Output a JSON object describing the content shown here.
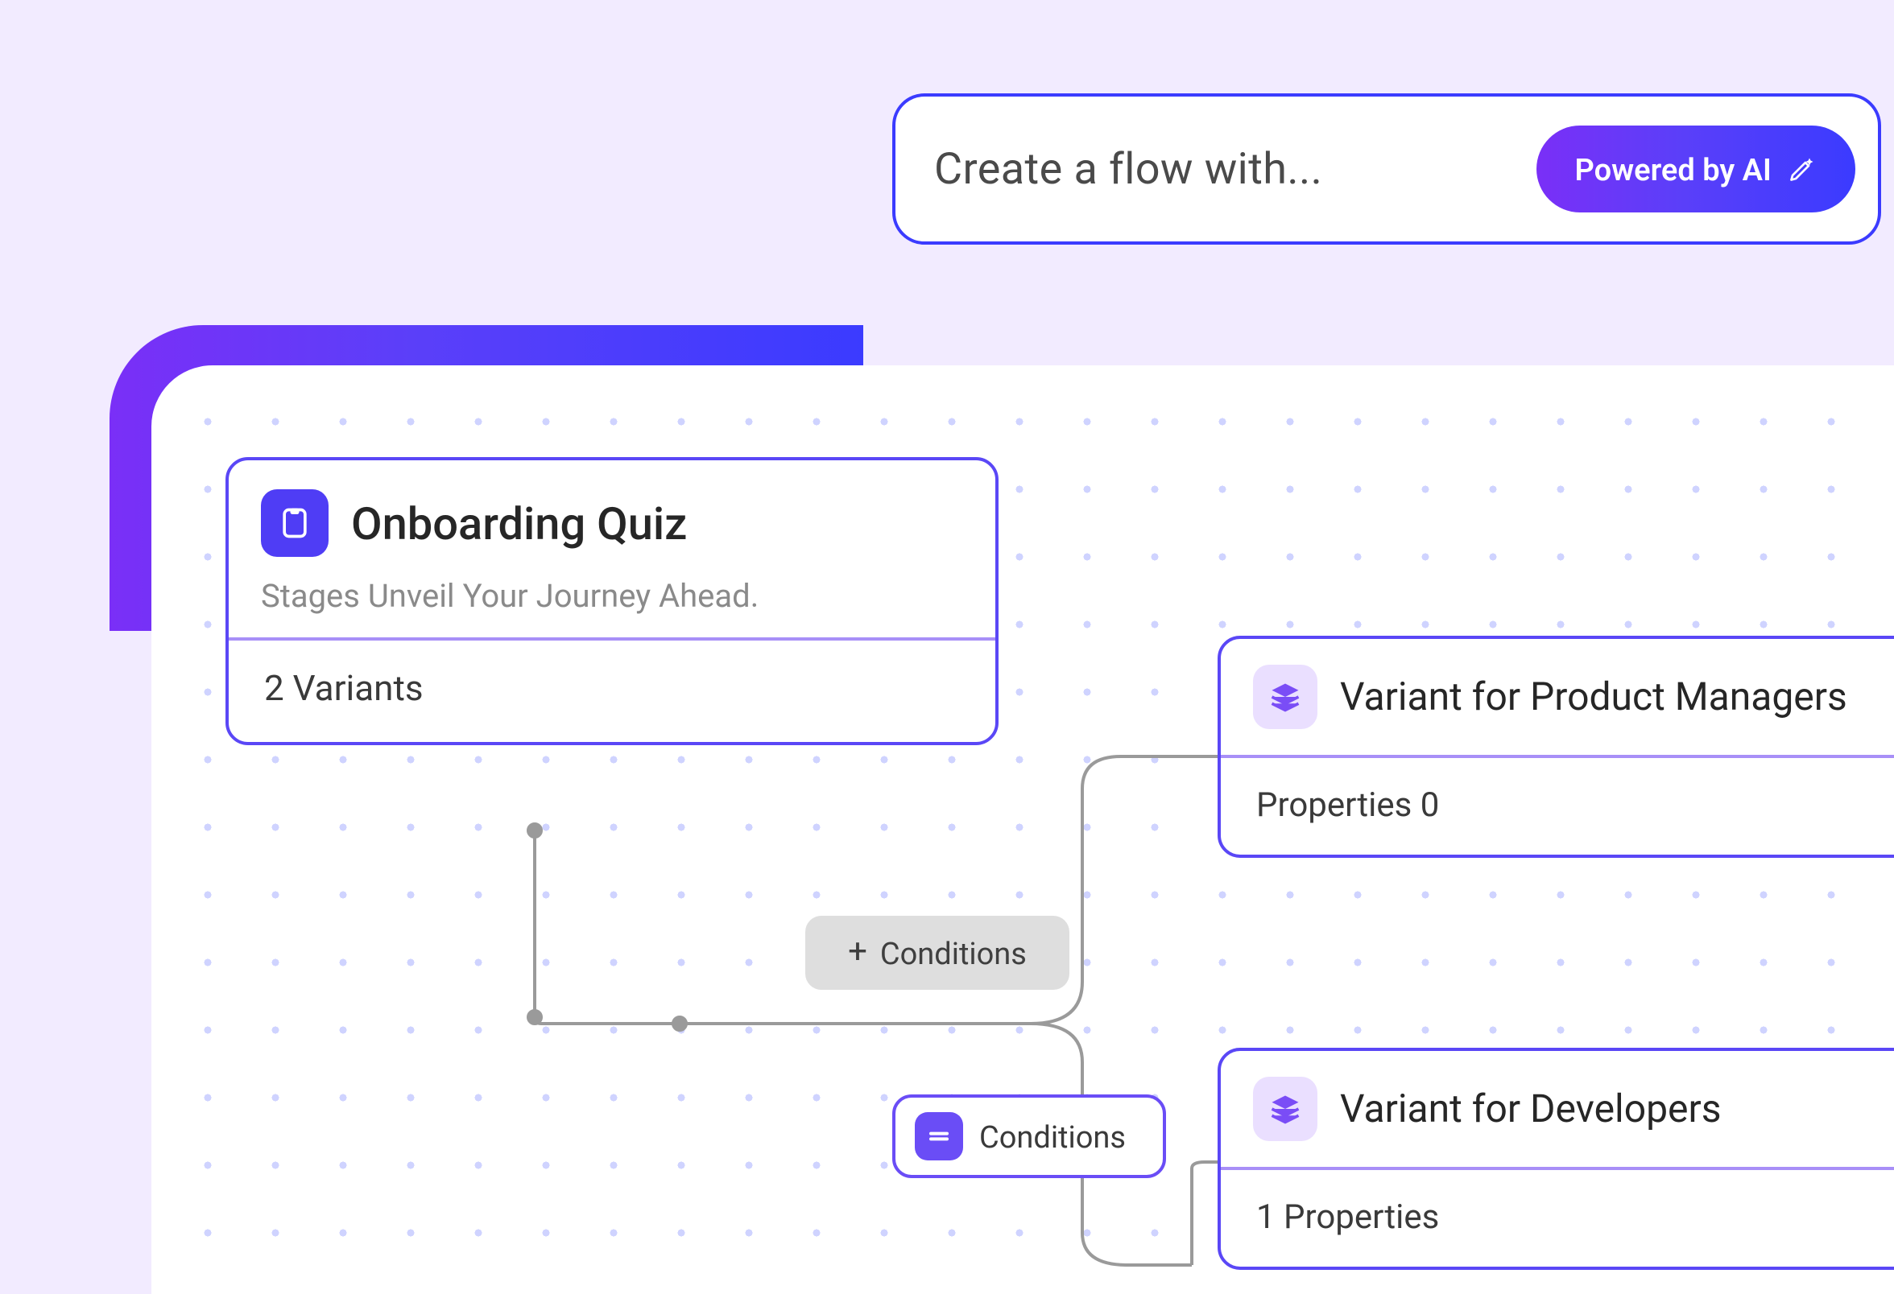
{
  "prompt": {
    "placeholder": "Create a flow with...",
    "ai_badge": "Powered by AI"
  },
  "root": {
    "title": "Onboarding Quiz",
    "subtitle": "Stages Unveil Your Journey Ahead.",
    "footer": "2 Variants"
  },
  "conditions": {
    "add_label": "Conditions",
    "chip_label": "Conditions"
  },
  "variants": [
    {
      "title": "Variant for Product Managers",
      "footer": "Properties 0"
    },
    {
      "title": "Variant for Developers",
      "footer": "1 Properties"
    }
  ]
}
